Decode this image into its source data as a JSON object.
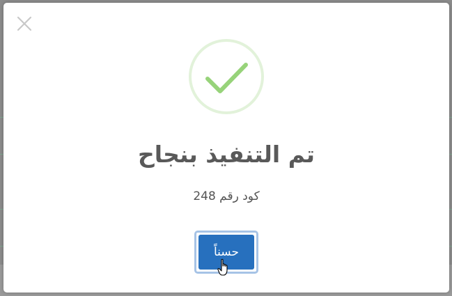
{
  "dialog": {
    "close_icon": "close-icon",
    "success_icon": "checkmark-circle-icon",
    "title": "تم التنفيذ بنجاح",
    "message": "كود رقم 248",
    "confirm_label": "حسناً"
  },
  "colors": {
    "success_ring": "#e2f2da",
    "success_check": "#97d37a",
    "button": "#2770be",
    "button_focus": "#a6c3e6",
    "title_text": "#595959",
    "overlay": "#8c8c8c"
  }
}
